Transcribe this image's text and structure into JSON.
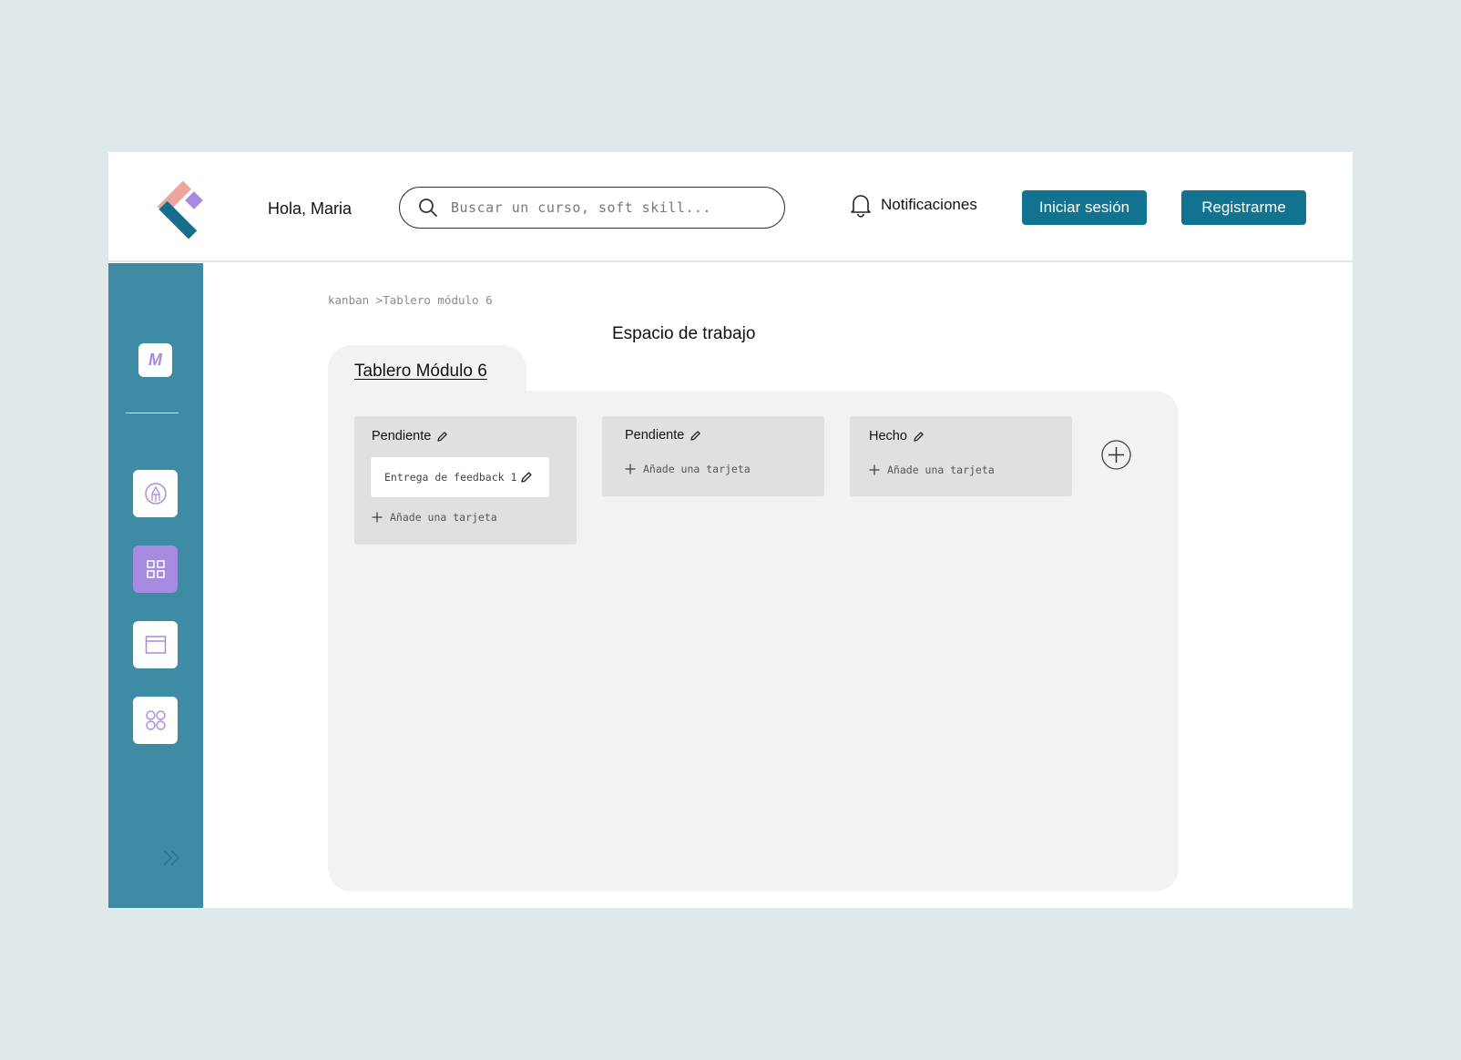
{
  "header": {
    "greeting": "Hola, Maria",
    "search_placeholder": "Buscar un curso, soft skill...",
    "notifications_label": "Notificaciones",
    "login_label": "Iniciar sesión",
    "register_label": "Registrarme"
  },
  "sidebar": {
    "profile_initial": "M",
    "items": [
      {
        "icon": "pencil-circle-icon",
        "active": false
      },
      {
        "icon": "grid-icon",
        "active": true
      },
      {
        "icon": "window-icon",
        "active": false
      },
      {
        "icon": "circles-icon",
        "active": false
      }
    ]
  },
  "main": {
    "breadcrumb": "kanban >Tablero módulo 6",
    "workspace_title": "Espacio de trabajo",
    "board_tab": "Tablero Módulo 6",
    "columns": [
      {
        "title": "Pendiente",
        "cards": [
          "Entrega de feedback 1"
        ],
        "add_label": "Añade una tarjeta"
      },
      {
        "title": "Pendiente",
        "cards": [],
        "add_label": "Añade una tarjeta"
      },
      {
        "title": "Hecho",
        "cards": [],
        "add_label": "Añade una tarjeta"
      }
    ]
  },
  "colors": {
    "accent": "#127391",
    "sidebar": "#3e8ba5",
    "active_item": "#a78be0",
    "background": "#dfe8ea"
  }
}
